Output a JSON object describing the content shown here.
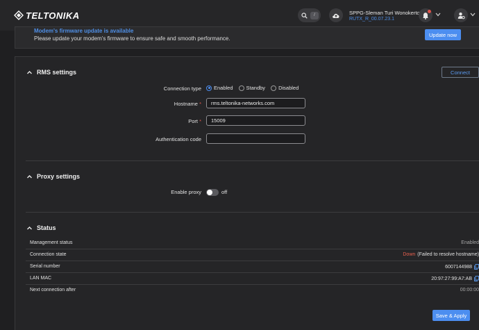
{
  "header": {
    "brand": "TELTONIKA",
    "search_shortcut": "/",
    "device_name": "SPPG-Sleman Turi Wonokerto",
    "firmware": "RUTX_R_00.07.23.1"
  },
  "banner": {
    "title": "Modem's firmware update is available",
    "text": "Please update your modem's firmware to ensure safe and smooth performance.",
    "button": "Update now"
  },
  "rms": {
    "title": "RMS settings",
    "connect_button": "Connect",
    "connection_type_label": "Connection type",
    "options": [
      "Enabled",
      "Standby",
      "Disabled"
    ],
    "selected": "Enabled",
    "hostname_label": "Hostname",
    "hostname_value": "rms.teltonika-networks.com",
    "port_label": "Port",
    "port_value": "15009",
    "auth_label": "Authentication code",
    "auth_value": ""
  },
  "proxy": {
    "title": "Proxy settings",
    "enable_label": "Enable proxy",
    "toggle_state": "off"
  },
  "status": {
    "title": "Status",
    "rows": [
      {
        "key": "Management status",
        "value": "Enabled"
      },
      {
        "key": "Connection state",
        "value_down": "Down",
        "value": "(Failed to resolve hostname)"
      },
      {
        "key": "Serial number",
        "value": "6007144988"
      },
      {
        "key": "LAN MAC",
        "value": "20:97:27:99:A7:AB"
      },
      {
        "key": "Next connection after",
        "value": "00:00:00"
      }
    ]
  },
  "footer": {
    "save_button": "Save & Apply"
  },
  "colors": {
    "accent": "#4c8ef0",
    "danger": "#e8604e",
    "background": "#1f1f21"
  }
}
